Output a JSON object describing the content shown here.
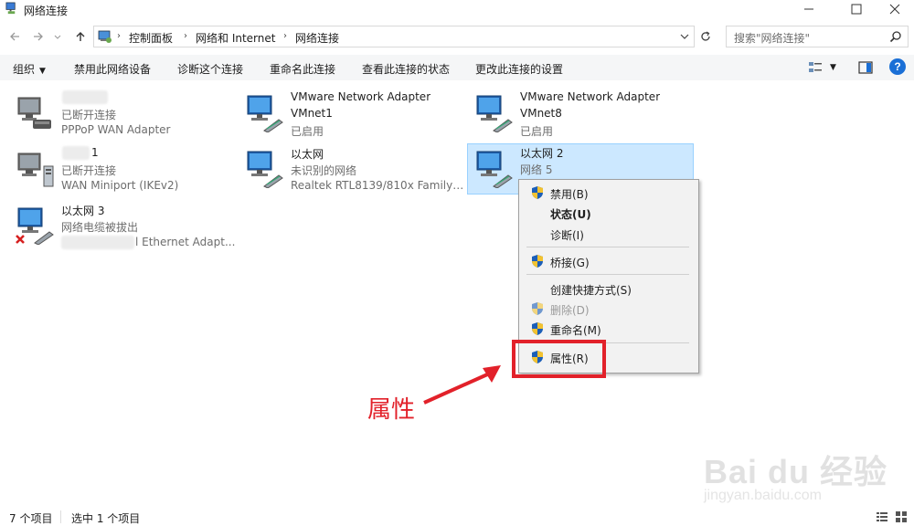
{
  "window": {
    "title": "网络连接"
  },
  "address": {
    "crumbs": [
      "控制面板",
      "网络和 Internet",
      "网络连接"
    ]
  },
  "search": {
    "placeholder": "搜索\"网络连接\""
  },
  "toolbar": {
    "organize": "组织",
    "disable": "禁用此网络设备",
    "diagnose": "诊断这个连接",
    "rename": "重命名此连接",
    "view_status": "查看此连接的状态",
    "change_settings": "更改此连接的设置"
  },
  "items": [
    {
      "name": "",
      "status": "已断开连接",
      "device": "PPPoP WAN Adapter"
    },
    {
      "name": "VMware Network Adapter",
      "status": "VMnet1",
      "device": "已启用"
    },
    {
      "name": "VMware Network Adapter",
      "status": "VMnet8",
      "device": "已启用"
    },
    {
      "name": "1",
      "status": "已断开连接",
      "device": "WAN Miniport (IKEv2)"
    },
    {
      "name": "以太网",
      "status": "未识别的网络",
      "device": "Realtek RTL8139/810x Family F..."
    },
    {
      "name": "以太网 2",
      "status": "网络 5",
      "device": ""
    },
    {
      "name": "以太网 3",
      "status": "网络电缆被拔出",
      "device": "l Ethernet Adapt..."
    }
  ],
  "context_menu": {
    "disable": "禁用(B)",
    "status": "状态(U)",
    "diagnose": "诊断(I)",
    "bridge": "桥接(G)",
    "shortcut": "创建快捷方式(S)",
    "delete": "删除(D)",
    "rename": "重命名(M)",
    "properties": "属性(R)"
  },
  "annotation": {
    "text": "属性"
  },
  "statusbar": {
    "count": "7 个项目",
    "selected": "选中 1 个项目"
  },
  "watermark": {
    "brand": "Bai du 经验",
    "url": "jingyan.baidu.com"
  },
  "colors": {
    "accent": "#1a6fd6",
    "selection": "#cce8ff",
    "annotation": "#e2212a"
  }
}
